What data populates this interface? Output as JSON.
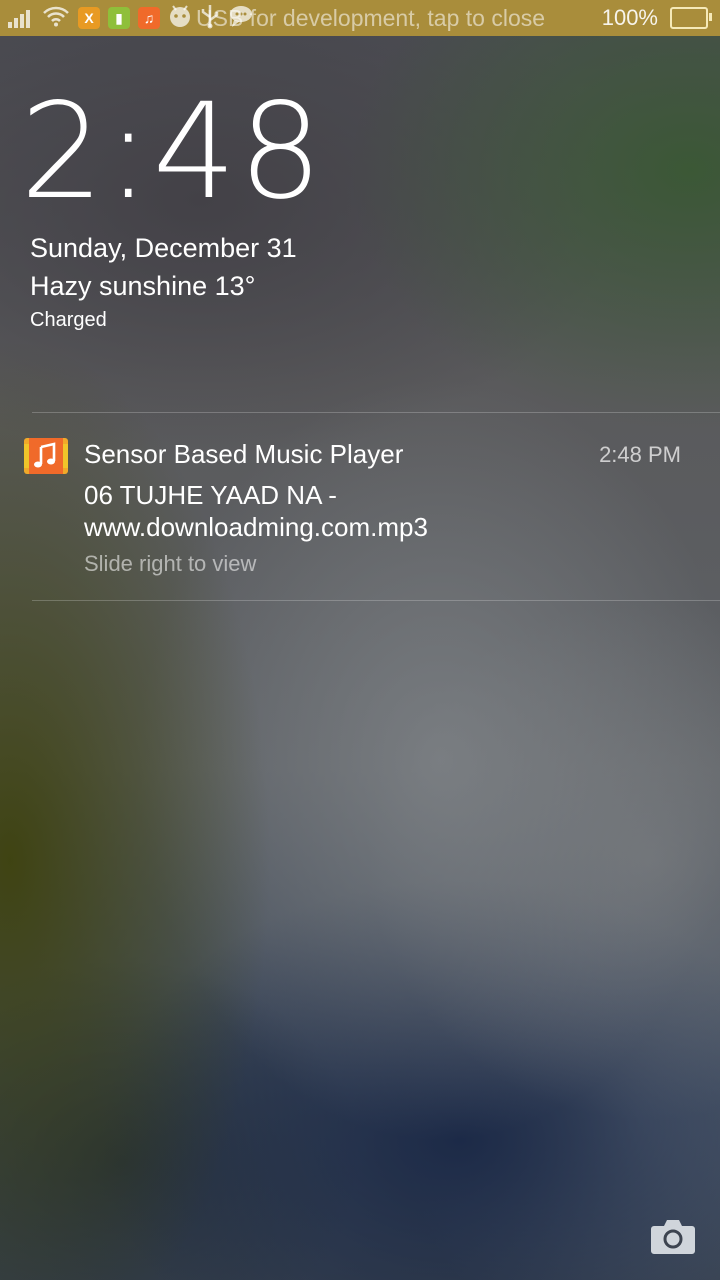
{
  "status_bar": {
    "usb_debug_text": "USB for development, tap to close",
    "battery_percent": "100%",
    "battery_level": 1.0,
    "color": "#a98d3b",
    "icons": [
      "signal-icon",
      "wifi-icon",
      "app-notification-icon",
      "battery-saver-icon",
      "music-player-icon",
      "android-debug-icon",
      "usb-icon",
      "chat-icon",
      "battery-icon"
    ]
  },
  "lockscreen": {
    "time": "2:48",
    "date": "Sunday, December 31",
    "weather": "Hazy sunshine 13°",
    "charge_status": "Charged"
  },
  "notification": {
    "app_name": "Sensor Based Music Player",
    "time": "2:48 PM",
    "body_line1": "06 TUJHE YAAD NA -",
    "body_line2": "www.downloadming.com.mp3",
    "hint": "Slide right to view",
    "icon": "music-note-icon",
    "icon_color": "#f06a2a"
  },
  "shortcuts": {
    "camera_icon": "camera-icon"
  }
}
